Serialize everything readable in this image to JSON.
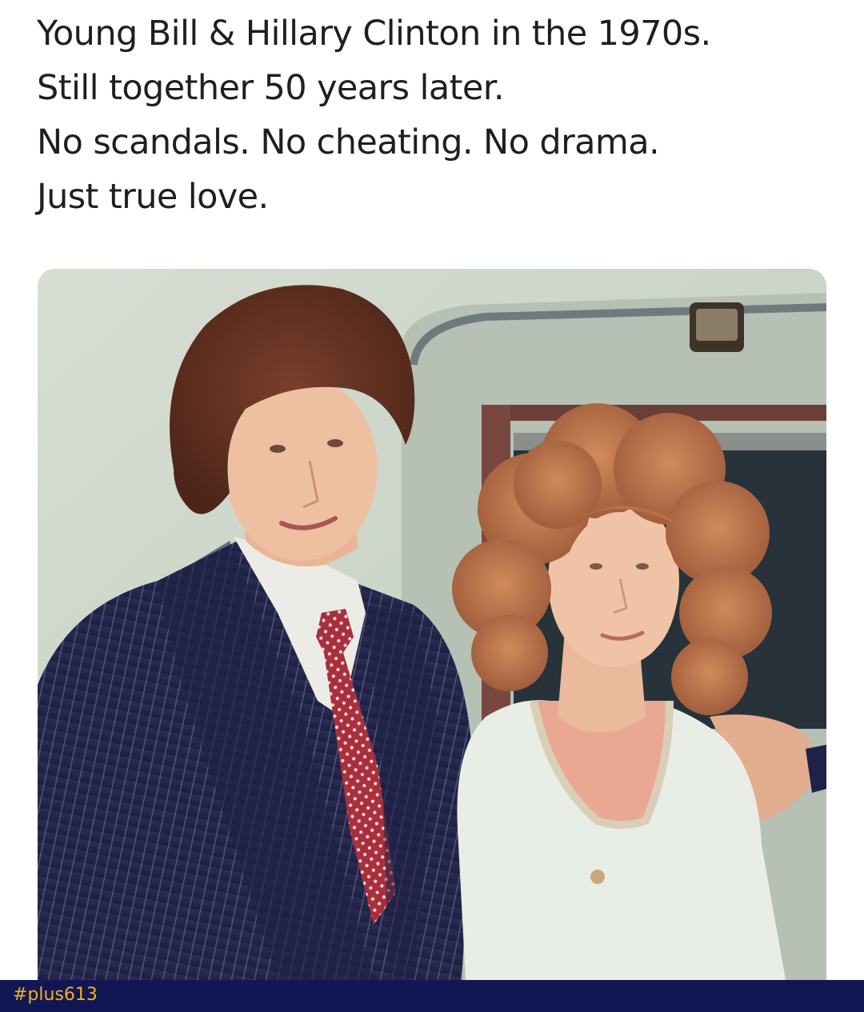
{
  "caption": {
    "lines": [
      "Young Bill & Hillary Clinton in the 1970s.",
      "Still together 50 years later.",
      "No scandals. No cheating. No drama.",
      "Just true love."
    ]
  },
  "photo": {
    "subject": "couple-photo"
  },
  "footer": {
    "watermark": "#plus613",
    "bar_color": "#121653",
    "watermark_color": "#f2b21d"
  }
}
